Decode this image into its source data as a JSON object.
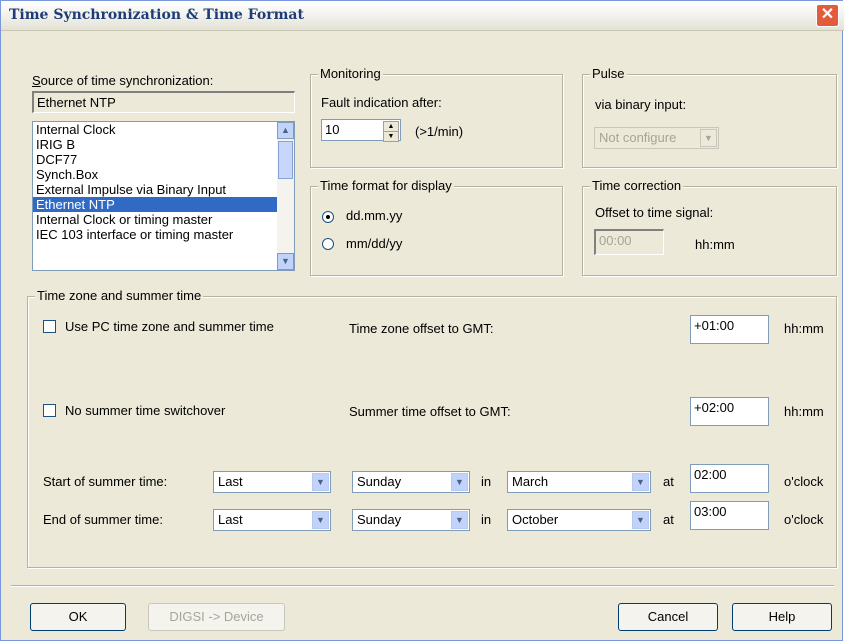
{
  "window": {
    "title": "Time Synchronization & Time Format",
    "close_glyph": "✕"
  },
  "source": {
    "label": "Source of time synchronization:",
    "current": "Ethernet NTP",
    "items": [
      "Internal Clock",
      "IRIG B",
      "DCF77",
      "Synch.Box",
      "External Impulse via Binary Input",
      "Ethernet NTP",
      "Internal Clock or timing master",
      "IEC 103 interface or timing master"
    ],
    "selected_index": 5
  },
  "monitoring": {
    "legend": "Monitoring",
    "fault_label": "Fault indication after:",
    "value": "10",
    "unit": "(>1/min)"
  },
  "pulse": {
    "legend": "Pulse",
    "binary_label": "via binary input:",
    "value": "Not configure"
  },
  "time_format": {
    "legend": "Time format for display",
    "option1": "dd.mm.yy",
    "option2": "mm/dd/yy",
    "selected": "dd.mm.yy"
  },
  "time_correction": {
    "legend": "Time correction",
    "offset_label": "Offset to time signal:",
    "value": "00:00",
    "unit": "hh:mm"
  },
  "timezone": {
    "legend": "Time zone and summer time",
    "use_pc_label": "Use PC time zone and summer time",
    "use_pc_checked": false,
    "tz_offset_label": "Time zone offset to GMT:",
    "tz_offset_value": "+01:00",
    "no_summer_label": "No summer time switchover",
    "no_summer_checked": false,
    "summer_offset_label": "Summer time offset to GMT:",
    "summer_offset_value": "+02:00",
    "unit": "hh:mm",
    "start_label": "Start of summer time:",
    "end_label": "End of summer time:",
    "in_label": "in",
    "at_label": "at",
    "oclock_label": "o'clock",
    "start": {
      "week": "Last",
      "day": "Sunday",
      "month": "March",
      "time": "02:00"
    },
    "end": {
      "week": "Last",
      "day": "Sunday",
      "month": "October",
      "time": "03:00"
    }
  },
  "buttons": {
    "ok": "OK",
    "digsi": "DIGSI -> Device",
    "cancel": "Cancel",
    "help": "Help"
  }
}
